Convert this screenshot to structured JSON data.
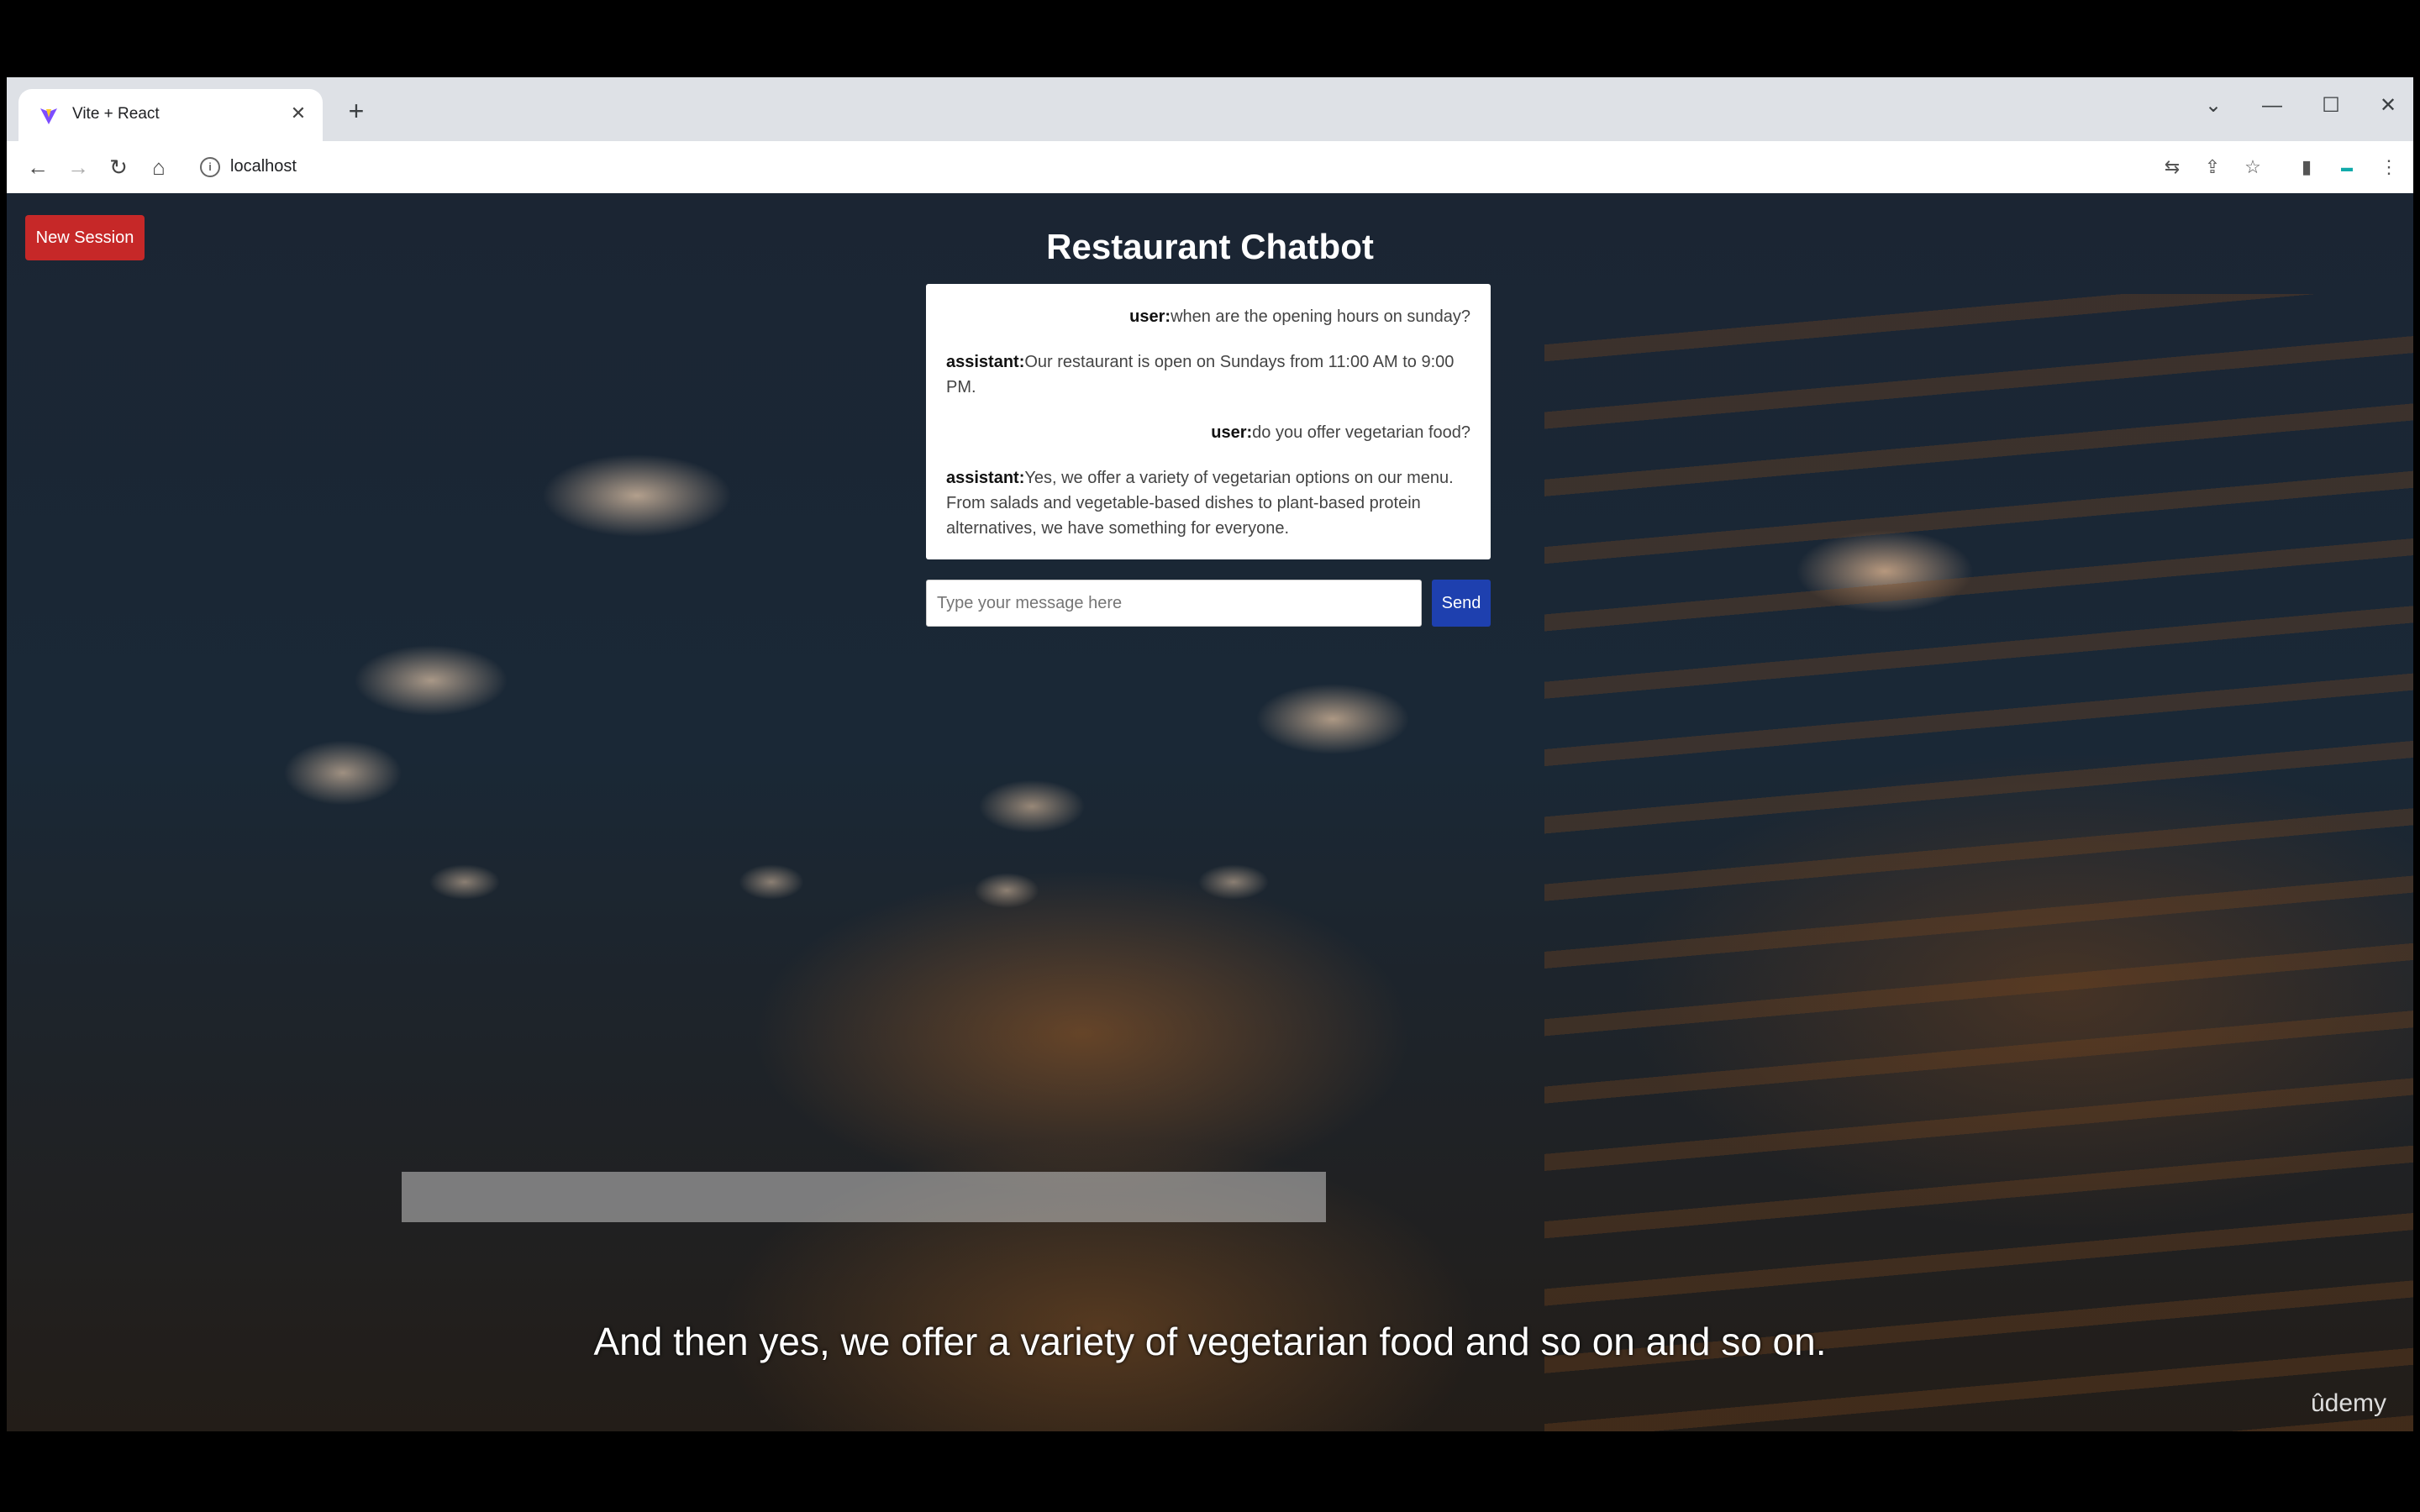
{
  "browser": {
    "tab_title": "Vite + React",
    "tab_close": "✕",
    "new_tab": "+",
    "url": "localhost",
    "window_controls": [
      "⌄",
      "—",
      "☐",
      "✕"
    ]
  },
  "app": {
    "new_session_label": "New Session",
    "title": "Restaurant Chatbot",
    "messages": [
      {
        "role": "user:",
        "text": "when are the opening hours on sunday?"
      },
      {
        "role": "assistant:",
        "text": "Our restaurant is open on Sundays from 11:00 AM to 9:00 PM."
      },
      {
        "role": "user:",
        "text": "do you offer vegetarian food?"
      },
      {
        "role": "assistant:",
        "text": "Yes, we offer a variety of vegetarian options on our menu. From salads and vegetable-based dishes to plant-based protein alternatives, we have something for everyone."
      }
    ],
    "input_placeholder": "Type your message here",
    "send_label": "Send"
  },
  "overlay": {
    "subtitle": "And then yes, we offer a variety of vegetarian food and so on and so on.",
    "watermark": "ûdemy"
  },
  "icons": {
    "back": "back-arrow-icon",
    "forward": "forward-arrow-icon",
    "reload": "reload-icon",
    "home": "home-icon",
    "info": "site-info-icon",
    "translate": "translate-icon",
    "share": "share-icon",
    "bookmark": "star-icon",
    "sidepanel": "side-panel-icon",
    "extension": "extension-icon",
    "menu": "kebab-menu-icon"
  },
  "colors": {
    "new_session_button": "#c62828",
    "send_button": "#1e40af"
  }
}
